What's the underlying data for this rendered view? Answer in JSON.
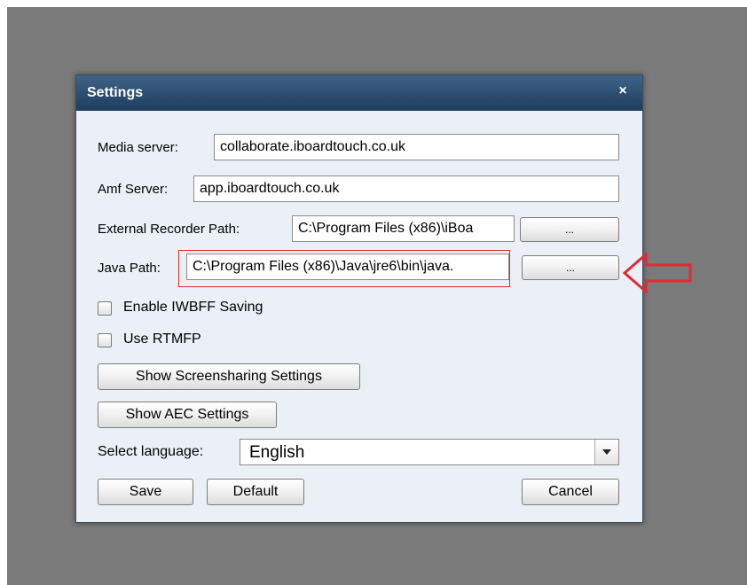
{
  "dialog": {
    "title": "Settings",
    "close_glyph": "×"
  },
  "fields": {
    "media_server": {
      "label": "Media server:",
      "value": "collaborate.iboardtouch.co.uk"
    },
    "amf_server": {
      "label": "Amf Server:",
      "value": "app.iboardtouch.co.uk"
    },
    "external_recorder": {
      "label": "External Recorder Path:",
      "value": "C:\\Program Files (x86)\\iBoa",
      "browse_label": "..."
    },
    "java_path": {
      "label": "Java Path:",
      "value": "C:\\Program Files (x86)\\Java\\jre6\\bin\\java.",
      "browse_label": "..."
    }
  },
  "checkboxes": {
    "iwbff": {
      "label": "Enable IWBFF Saving",
      "checked": false
    },
    "rtmfp": {
      "label": "Use RTMFP",
      "checked": false
    }
  },
  "buttons": {
    "screensharing": "Show Screensharing Settings",
    "aec": "Show AEC Settings",
    "save": "Save",
    "default": "Default",
    "cancel": "Cancel"
  },
  "language": {
    "label": "Select language:",
    "selected": "English"
  },
  "annotation": {
    "highlight_color": "#e02a34",
    "arrow_icon": "red-outline-arrow-left"
  },
  "colors": {
    "titlebar": "#2c4d70",
    "dialog_bg": "#eaf0f6",
    "backdrop": "#7a7a7a"
  }
}
